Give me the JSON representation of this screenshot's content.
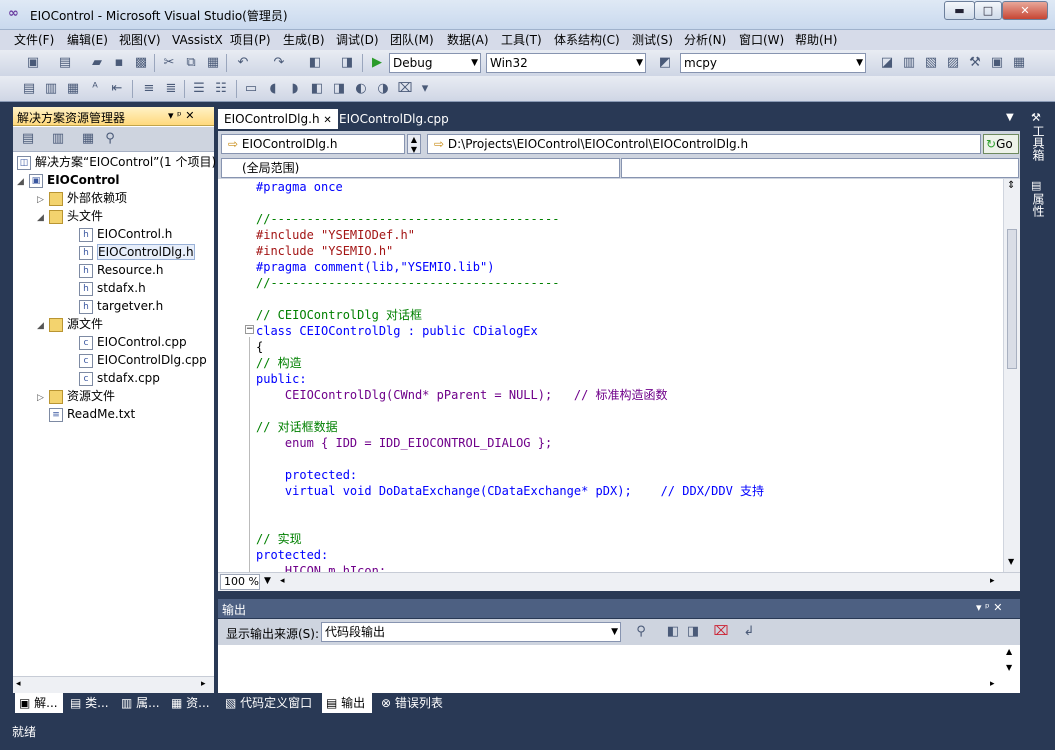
{
  "window": {
    "title": "EIOControl - Microsoft Visual Studio(管理员)",
    "logo_glyph": "∞",
    "minimize_glyph": "▬",
    "maximize_glyph": "□",
    "close_glyph": "✕"
  },
  "menu": [
    "文件(F)",
    "编辑(E)",
    "视图(V)",
    "VAssistX",
    "项目(P)",
    "生成(B)",
    "调试(D)",
    "团队(M)",
    "数据(A)",
    "工具(T)",
    "体系结构(C)",
    "测试(S)",
    "分析(N)",
    "窗口(W)",
    "帮助(H)"
  ],
  "toolbar": {
    "configuration": "Debug",
    "platform": "Win32",
    "find_text": "mcpy",
    "start_glyph": "▶"
  },
  "solution_explorer": {
    "title": "解决方案资源管理器",
    "header_glyphs": "▾ ᵖ ✕",
    "solution_label": "解决方案“EIOControl”(1 个项目)",
    "project": "EIOControl",
    "external_deps": "外部依赖项",
    "headers_folder": "头文件",
    "headers": [
      "EIOControl.h",
      "EIOControlDlg.h",
      "Resource.h",
      "stdafx.h",
      "targetver.h"
    ],
    "sources_folder": "源文件",
    "sources": [
      "EIOControl.cpp",
      "EIOControlDlg.cpp",
      "stdafx.cpp"
    ],
    "resources_folder": "资源文件",
    "readme": "ReadMe.txt"
  },
  "editor": {
    "tabs": [
      {
        "label": "EIOControlDlg.h",
        "close": "✕"
      },
      {
        "label": "EIOControlDlg.cpp"
      }
    ],
    "class_combo": "EIOControlDlg.h",
    "path_combo": "D:\\Projects\\EIOControl\\EIOControl\\EIOControlDlg.h",
    "go_label": "Go",
    "scope_combo": "(全局范围)",
    "zoom": "100 %",
    "code_lines": [
      "#pragma once",
      "",
      "//----------------------------------------",
      "#include \"YSEMIODef.h\"",
      "#include \"YSEMIO.h\"",
      "#pragma comment(lib,\"YSEMIO.lib\")",
      "//----------------------------------------",
      "",
      "// CEIOControlDlg 对话框",
      "class CEIOControlDlg : public CDialogEx",
      "{",
      "// 构造",
      "public:",
      "    CEIOControlDlg(CWnd* pParent = NULL);   // 标准构造函数",
      "",
      "// 对话框数据",
      "    enum { IDD = IDD_EIOCONTROL_DIALOG };",
      "",
      "    protected:",
      "    virtual void DoDataExchange(CDataExchange* pDX);    // DDX/DDV 支持",
      "",
      "",
      "// 实现",
      "protected:",
      "    HICON m_hIcon;"
    ]
  },
  "output": {
    "title": "输出",
    "source_label": "显示输出来源(S):",
    "source_value": "代码段输出"
  },
  "bottom_tabs": [
    "解...",
    "类...",
    "属...",
    "资...",
    "代码定义窗口",
    "输出",
    "错误列表"
  ],
  "right_dock": [
    "工具箱",
    "属性"
  ],
  "status": "就绪"
}
